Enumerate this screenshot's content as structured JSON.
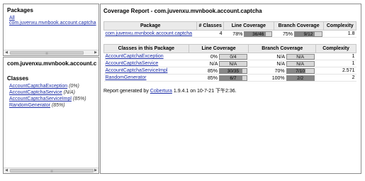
{
  "packages_pane": {
    "title": "Packages",
    "all_link": "All",
    "package_link": "com.juvenxu.mvnbook.account.captcha"
  },
  "classes_pane": {
    "package_title": "com.juvenxu.mvnbook.account.c",
    "classes_title": "Classes",
    "items": [
      {
        "name": "AccountCaptchaException",
        "pct": "(0%)"
      },
      {
        "name": "AccountCaptchaService",
        "pct": "(N/A)"
      },
      {
        "name": "AccountCaptchaServiceImpl",
        "pct": "(85%)"
      },
      {
        "name": "RandomGenerator",
        "pct": "(85%)"
      }
    ]
  },
  "report": {
    "title": "Coverage Report - com.juvenxu.mvnbook.account.captcha",
    "package_table": {
      "headers": [
        "Package",
        "# Classes",
        "Line Coverage",
        "Branch Coverage",
        "Complexity"
      ],
      "row": {
        "package": "com.juvenxu.mvnbook.account.captcha",
        "classes": "4",
        "line_pct": "78%",
        "line_ratio": "36/46",
        "line_fill": 0.78,
        "branch_pct": "75%",
        "branch_ratio": "9/12",
        "branch_fill": 0.75,
        "complexity": "1.8"
      }
    },
    "class_table": {
      "headers": [
        "Classes in this Package",
        "Line Coverage",
        "Branch Coverage",
        "Complexity"
      ],
      "rows": [
        {
          "name": "AccountCaptchaException",
          "line_pct": "0%",
          "line_ratio": "0/4",
          "line_fill": 0.0,
          "branch_pct": "N/A",
          "branch_ratio": "N/A",
          "branch_fill": 0,
          "complexity": "1"
        },
        {
          "name": "AccountCaptchaService",
          "line_pct": "N/A",
          "line_ratio": "N/A",
          "line_fill": 0,
          "branch_pct": "N/A",
          "branch_ratio": "N/A",
          "branch_fill": 0,
          "complexity": "1"
        },
        {
          "name": "AccountCaptchaServiceImpl",
          "line_pct": "85%",
          "line_ratio": "30/35",
          "line_fill": 0.85,
          "branch_pct": "70%",
          "branch_ratio": "7/10",
          "branch_fill": 0.7,
          "complexity": "2.571"
        },
        {
          "name": "RandomGenerator",
          "line_pct": "85%",
          "line_ratio": "6/7",
          "line_fill": 0.85,
          "branch_pct": "100%",
          "branch_ratio": "2/2",
          "branch_fill": 1.0,
          "complexity": "2"
        }
      ]
    },
    "footer": {
      "prefix": "Report generated by",
      "tool_link": "Cobertura",
      "suffix": "1.9.4.1 on 10-7-21 下午2:36."
    }
  },
  "colors": {
    "bar_fill": "#878787",
    "bar_empty": "#d8d8d8",
    "link": "#1d2ea8"
  }
}
